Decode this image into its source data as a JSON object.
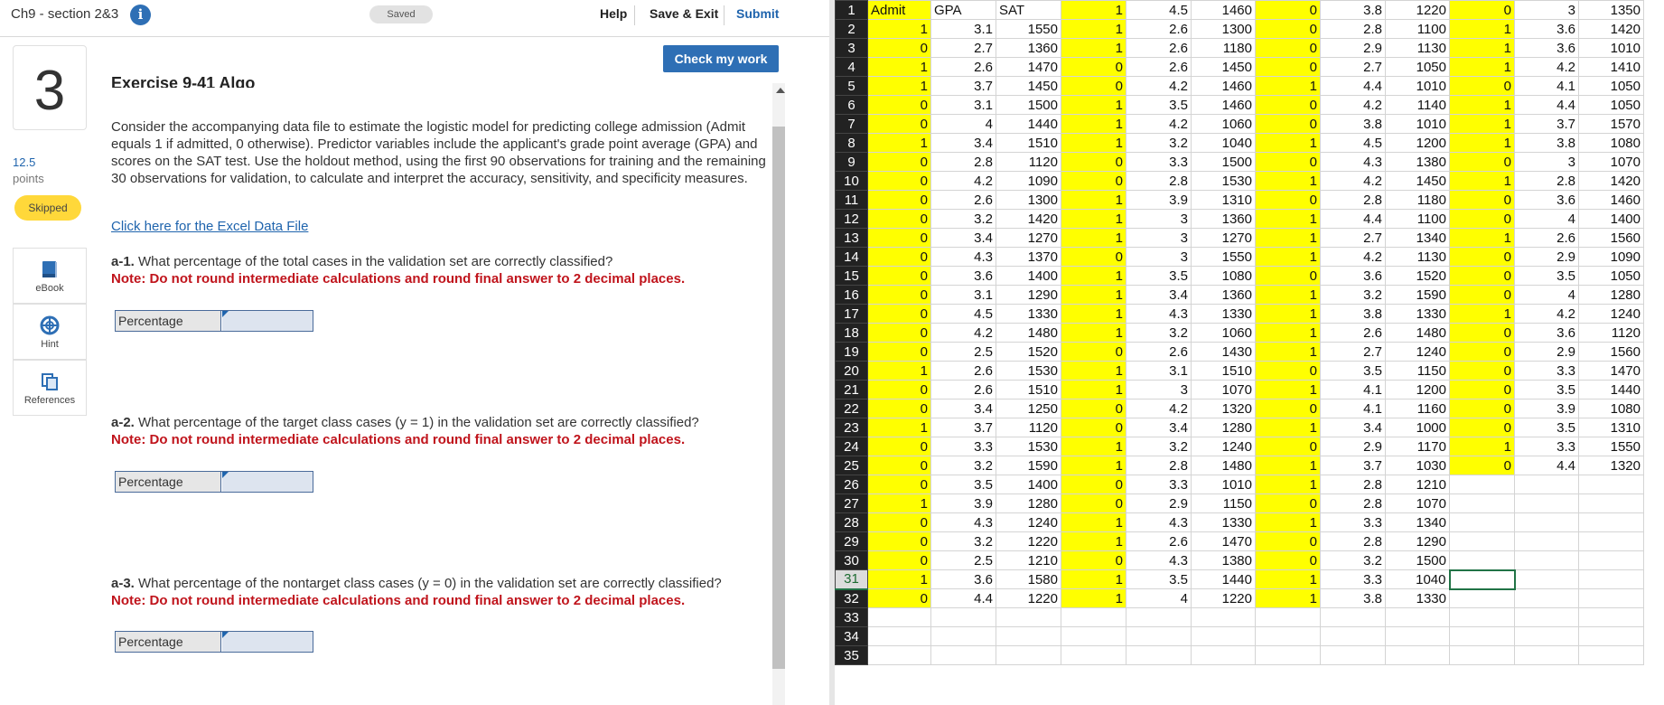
{
  "topbar": {
    "title": "Ch9 - section 2&3",
    "saved": "Saved",
    "help": "Help",
    "save_exit": "Save & Exit",
    "submit": "Submit"
  },
  "check_button": "Check my work",
  "question": {
    "number": "3",
    "points_value": "12.5",
    "points_label": "points",
    "status": "Skipped"
  },
  "sidebar_items": [
    {
      "label": "eBook",
      "icon": "ebook-icon"
    },
    {
      "label": "Hint",
      "icon": "hint-icon"
    },
    {
      "label": "References",
      "icon": "references-icon"
    }
  ],
  "exercise_title": "Exercise 9-41 Algo",
  "prompt": "Consider the accompanying data file to estimate the logistic model for predicting college admission (Admit equals 1 if admitted, 0 otherwise). Predictor variables include the applicant's grade point average (GPA) and scores on the SAT test. Use the holdout method, using the first 90 observations for training and the remaining 30 observations for validation, to calculate and interpret the accuracy, sensitivity, and specificity measures.",
  "data_link": "Click here for the Excel Data File",
  "questions": [
    {
      "id": "a-1.",
      "text": " What percentage of the total cases in the validation set are correctly classified?",
      "note": "Note: Do not round intermediate calculations and round final answer to 2 decimal places.",
      "answer_label": "Percentage"
    },
    {
      "id": "a-2.",
      "text": " What percentage of the target class cases (y = 1) in the validation set are correctly classified?",
      "note": "Note: Do not round intermediate calculations and round final answer to 2 decimal places.",
      "answer_label": "Percentage"
    },
    {
      "id": "a-3.",
      "text": " What percentage of the nontarget class cases (y = 0) in the validation set are correctly classified?",
      "note": "Note: Do not round intermediate calculations and round final answer to 2 decimal places.",
      "answer_label": "Percentage"
    }
  ],
  "spreadsheet": {
    "active_row": 31,
    "highlight_color": "#ffff00",
    "row_numbers": [
      "1",
      "2",
      "3",
      "4",
      "5",
      "6",
      "7",
      "8",
      "9",
      "10",
      "11",
      "12",
      "13",
      "14",
      "15",
      "16",
      "17",
      "18",
      "19",
      "20",
      "21",
      "22",
      "23",
      "24",
      "25",
      "26",
      "27",
      "28",
      "29",
      "30",
      "31",
      "32",
      "33",
      "34",
      "35"
    ],
    "rows": [
      [
        "Admit",
        "GPA",
        "SAT",
        "1",
        "4.5",
        "1460",
        "0",
        "3.8",
        "1220",
        "0",
        "3",
        "1350"
      ],
      [
        "1",
        "3.1",
        "1550",
        "1",
        "2.6",
        "1300",
        "0",
        "2.8",
        "1100",
        "1",
        "3.6",
        "1420"
      ],
      [
        "0",
        "2.7",
        "1360",
        "1",
        "2.6",
        "1180",
        "0",
        "2.9",
        "1130",
        "1",
        "3.6",
        "1010"
      ],
      [
        "1",
        "2.6",
        "1470",
        "0",
        "2.6",
        "1450",
        "0",
        "2.7",
        "1050",
        "1",
        "4.2",
        "1410"
      ],
      [
        "1",
        "3.7",
        "1450",
        "0",
        "4.2",
        "1460",
        "1",
        "4.4",
        "1010",
        "0",
        "4.1",
        "1050"
      ],
      [
        "0",
        "3.1",
        "1500",
        "1",
        "3.5",
        "1460",
        "0",
        "4.2",
        "1140",
        "1",
        "4.4",
        "1050"
      ],
      [
        "0",
        "4",
        "1440",
        "1",
        "4.2",
        "1060",
        "0",
        "3.8",
        "1010",
        "1",
        "3.7",
        "1570"
      ],
      [
        "1",
        "3.4",
        "1510",
        "1",
        "3.2",
        "1040",
        "1",
        "4.5",
        "1200",
        "1",
        "3.8",
        "1080"
      ],
      [
        "0",
        "2.8",
        "1120",
        "0",
        "3.3",
        "1500",
        "0",
        "4.3",
        "1380",
        "0",
        "3",
        "1070"
      ],
      [
        "0",
        "4.2",
        "1090",
        "0",
        "2.8",
        "1530",
        "1",
        "4.2",
        "1450",
        "1",
        "2.8",
        "1420"
      ],
      [
        "0",
        "2.6",
        "1300",
        "1",
        "3.9",
        "1310",
        "0",
        "2.8",
        "1180",
        "0",
        "3.6",
        "1460"
      ],
      [
        "0",
        "3.2",
        "1420",
        "1",
        "3",
        "1360",
        "1",
        "4.4",
        "1100",
        "0",
        "4",
        "1400"
      ],
      [
        "0",
        "3.4",
        "1270",
        "1",
        "3",
        "1270",
        "1",
        "2.7",
        "1340",
        "1",
        "2.6",
        "1560"
      ],
      [
        "0",
        "4.3",
        "1370",
        "0",
        "3",
        "1550",
        "1",
        "4.2",
        "1130",
        "0",
        "2.9",
        "1090"
      ],
      [
        "0",
        "3.6",
        "1400",
        "1",
        "3.5",
        "1080",
        "0",
        "3.6",
        "1520",
        "0",
        "3.5",
        "1050"
      ],
      [
        "0",
        "3.1",
        "1290",
        "1",
        "3.4",
        "1360",
        "1",
        "3.2",
        "1590",
        "0",
        "4",
        "1280"
      ],
      [
        "0",
        "4.5",
        "1330",
        "1",
        "4.3",
        "1330",
        "1",
        "3.8",
        "1330",
        "1",
        "4.2",
        "1240"
      ],
      [
        "0",
        "4.2",
        "1480",
        "1",
        "3.2",
        "1060",
        "1",
        "2.6",
        "1480",
        "0",
        "3.6",
        "1120"
      ],
      [
        "0",
        "2.5",
        "1520",
        "0",
        "2.6",
        "1430",
        "1",
        "2.7",
        "1240",
        "0",
        "2.9",
        "1560"
      ],
      [
        "1",
        "2.6",
        "1530",
        "1",
        "3.1",
        "1510",
        "0",
        "3.5",
        "1150",
        "0",
        "3.3",
        "1470"
      ],
      [
        "0",
        "2.6",
        "1510",
        "1",
        "3",
        "1070",
        "1",
        "4.1",
        "1200",
        "0",
        "3.5",
        "1440"
      ],
      [
        "0",
        "3.4",
        "1250",
        "0",
        "4.2",
        "1320",
        "0",
        "4.1",
        "1160",
        "0",
        "3.9",
        "1080"
      ],
      [
        "1",
        "3.7",
        "1120",
        "0",
        "3.4",
        "1280",
        "1",
        "3.4",
        "1000",
        "0",
        "3.5",
        "1310"
      ],
      [
        "0",
        "3.3",
        "1530",
        "1",
        "3.2",
        "1240",
        "0",
        "2.9",
        "1170",
        "1",
        "3.3",
        "1550"
      ],
      [
        "0",
        "3.2",
        "1590",
        "1",
        "2.8",
        "1480",
        "1",
        "3.7",
        "1030",
        "0",
        "4.4",
        "1320"
      ],
      [
        "0",
        "3.5",
        "1400",
        "0",
        "3.3",
        "1010",
        "1",
        "2.8",
        "1210",
        "",
        "",
        ""
      ],
      [
        "1",
        "3.9",
        "1280",
        "0",
        "2.9",
        "1150",
        "0",
        "2.8",
        "1070",
        "",
        "",
        ""
      ],
      [
        "0",
        "4.3",
        "1240",
        "1",
        "4.3",
        "1330",
        "1",
        "3.3",
        "1340",
        "",
        "",
        ""
      ],
      [
        "0",
        "3.2",
        "1220",
        "1",
        "2.6",
        "1470",
        "0",
        "2.8",
        "1290",
        "",
        "",
        ""
      ],
      [
        "0",
        "2.5",
        "1210",
        "0",
        "4.3",
        "1380",
        "0",
        "3.2",
        "1500",
        "",
        "",
        ""
      ],
      [
        "1",
        "3.6",
        "1580",
        "1",
        "3.5",
        "1440",
        "1",
        "3.3",
        "1040",
        "",
        "",
        ""
      ],
      [
        "0",
        "4.4",
        "1220",
        "1",
        "4",
        "1220",
        "1",
        "3.8",
        "1330",
        "",
        "",
        ""
      ],
      [
        "",
        "",
        "",
        "",
        "",
        "",
        "",
        "",
        "",
        "",
        "",
        ""
      ],
      [
        "",
        "",
        "",
        "",
        "",
        "",
        "",
        "",
        "",
        "",
        "",
        ""
      ],
      [
        "",
        "",
        "",
        "",
        "",
        "",
        "",
        "",
        "",
        "",
        "",
        ""
      ]
    ]
  }
}
